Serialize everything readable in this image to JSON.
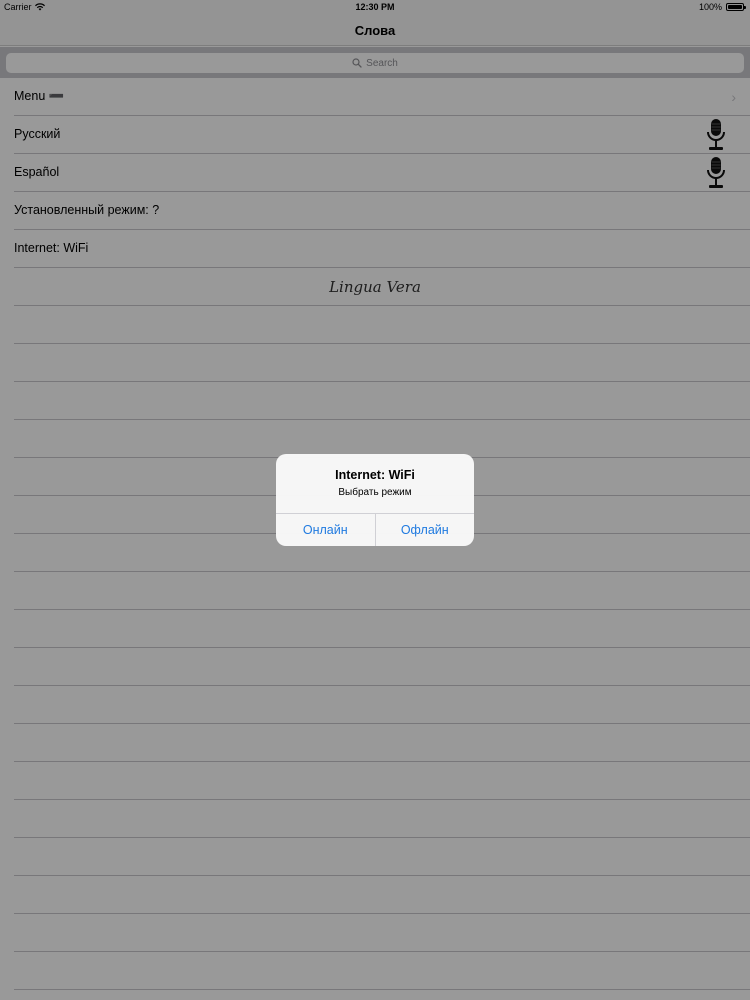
{
  "status_bar": {
    "carrier": "Carrier",
    "time": "12:30 PM",
    "battery": "100%",
    "battery_level": 1.0
  },
  "nav": {
    "title": "Слова"
  },
  "search": {
    "placeholder": "Search"
  },
  "rows": [
    {
      "label": "Menu ➖",
      "accessory": "chevron-right-icon"
    },
    {
      "label": "Русский",
      "accessory": "microphone-icon"
    },
    {
      "label": "Español",
      "accessory": "microphone-icon"
    },
    {
      "label": "Установленный режим: ?"
    },
    {
      "label": "Internet: WiFi"
    }
  ],
  "logo": {
    "text": "Lingua Vera"
  },
  "alert": {
    "title": "Internet: WiFi",
    "message": "Выбрать режим",
    "buttons": [
      "Онлайн",
      "Офлайн"
    ]
  },
  "colors": {
    "accent": "#1f7ae0",
    "overlay": "rgba(0,0,0,0.4)",
    "search_bar_bg": "#c9c9ce"
  }
}
